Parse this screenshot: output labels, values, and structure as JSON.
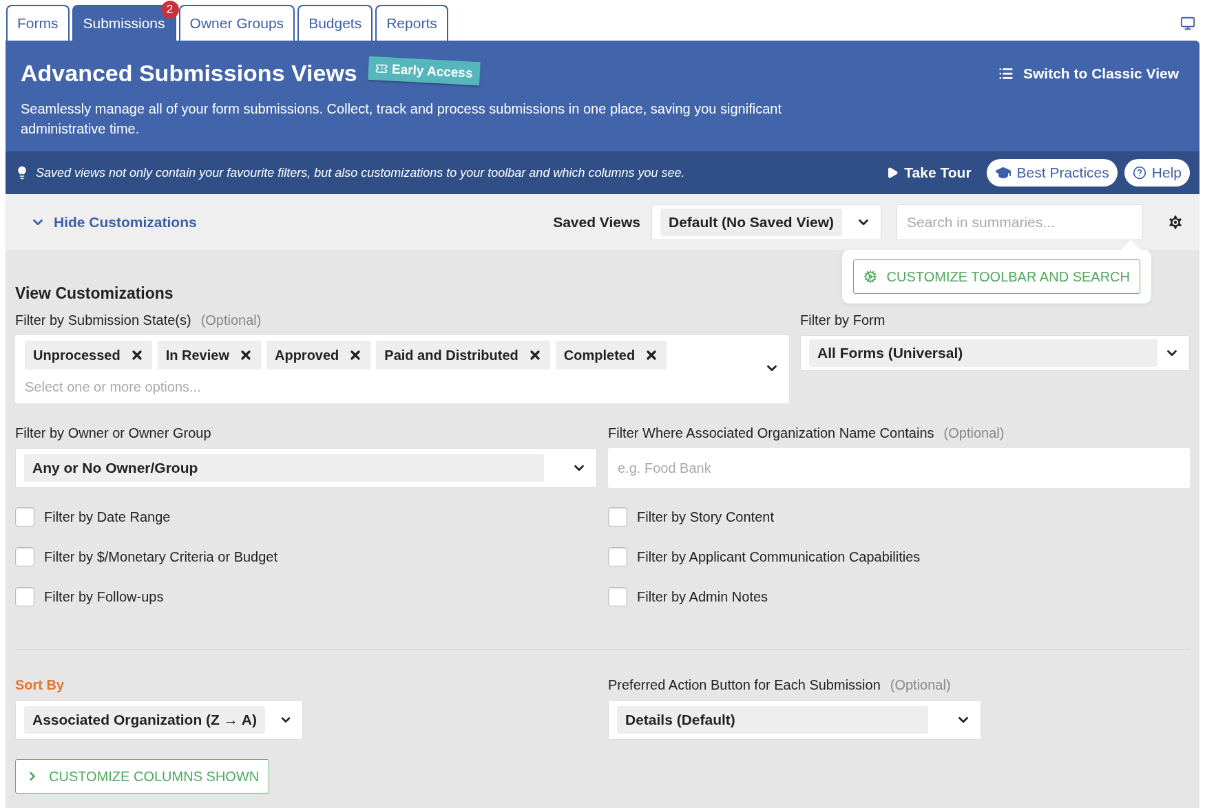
{
  "tabs": [
    {
      "label": "Forms",
      "selected": false
    },
    {
      "label": "Submissions",
      "selected": true,
      "badge": "2"
    },
    {
      "label": "Owner Groups",
      "selected": false
    },
    {
      "label": "Budgets",
      "selected": false
    },
    {
      "label": "Reports",
      "selected": false
    }
  ],
  "header": {
    "title": "Advanced Submissions Views",
    "badge": "Early Access",
    "description": "Seamlessly manage all of your form submissions. Collect, track and process submissions in one place, saving you significant administrative time.",
    "classic_view_link": "Switch to Classic View"
  },
  "tip_bar": {
    "text": "Saved views not only contain your favourite filters, but also customizations to your toolbar and which columns you see.",
    "take_tour": "Take Tour",
    "best_practices": "Best Practices",
    "help": "Help"
  },
  "toolbar": {
    "toggle": {
      "label": "Hide Customizations",
      "expanded": true
    },
    "saved_views_label": "Saved Views",
    "saved_view_value": "Default (No Saved View)",
    "search_placeholder": "Search in summaries..."
  },
  "popover": {
    "button": "CUSTOMIZE TOOLBAR AND SEARCH"
  },
  "customizations": {
    "heading": "View Customizations",
    "state_filter": {
      "label": "Filter by Submission State(s)",
      "optional": "(Optional)",
      "chips": [
        "Unprocessed",
        "In Review",
        "Approved",
        "Paid and Distributed",
        "Completed"
      ],
      "placeholder": "Select one or more options..."
    },
    "form_filter": {
      "label": "Filter by Form",
      "value": "All Forms (Universal)"
    },
    "owner_filter": {
      "label": "Filter by Owner or Owner Group",
      "value": "Any or No Owner/Group"
    },
    "org_filter": {
      "label": "Filter Where Associated Organization Name Contains",
      "optional": "(Optional)",
      "placeholder": "e.g. Food Bank"
    },
    "checkboxes_left": [
      {
        "label": "Filter by Date Range",
        "checked": false
      },
      {
        "label": "Filter by $/Monetary Criteria or Budget",
        "checked": false
      },
      {
        "label": "Filter by Follow-ups",
        "checked": false
      }
    ],
    "checkboxes_right": [
      {
        "label": "Filter by Story Content",
        "checked": false
      },
      {
        "label": "Filter by Applicant Communication Capabilities",
        "checked": false
      },
      {
        "label": "Filter by Admin Notes",
        "checked": false
      }
    ],
    "sort": {
      "label": "Sort By",
      "value": "Associated Organization (Z → A)"
    },
    "action": {
      "label": "Preferred Action Button for Each Submission",
      "optional": "(Optional)",
      "value": "Details (Default)"
    },
    "columns_button": {
      "label": "CUSTOMIZE COLUMNS SHOWN",
      "expanded": false
    }
  }
}
